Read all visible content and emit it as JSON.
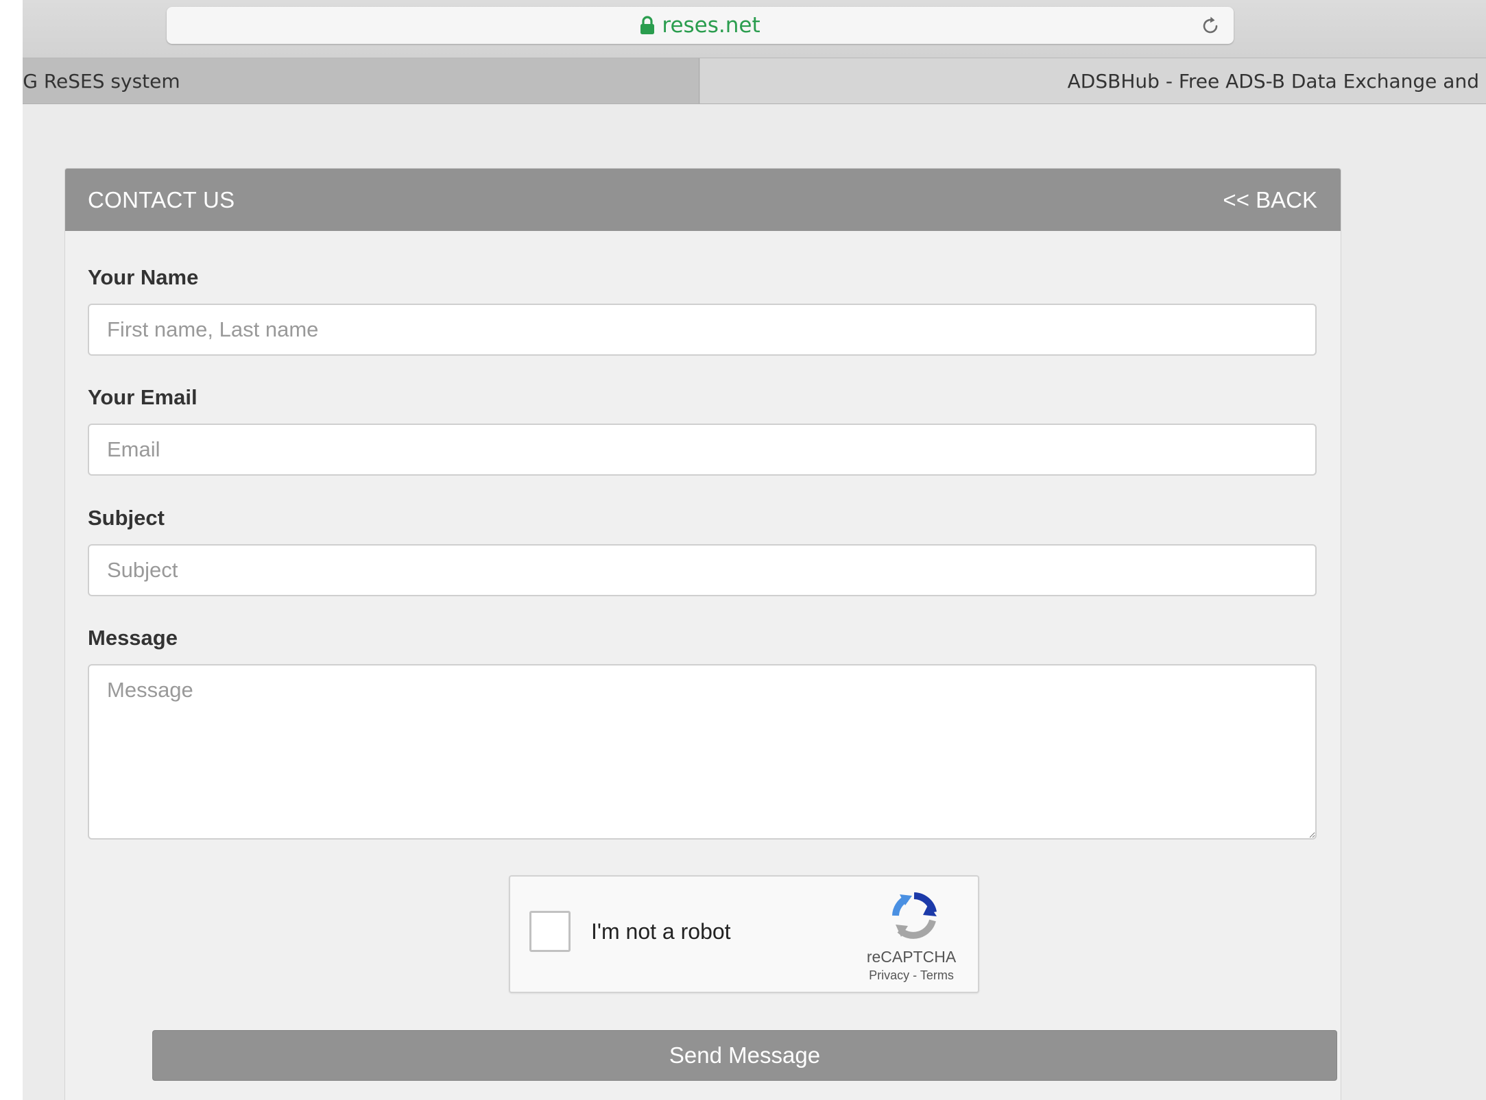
{
  "browser": {
    "url": "reses.net",
    "url_color": "#2a9d4e",
    "tabs": [
      {
        "label": "IG ReSES system",
        "active": true
      },
      {
        "label": "ADSBHub - Free ADS-B Data Exchange and",
        "active": false
      }
    ]
  },
  "panel": {
    "title": "CONTACT US",
    "back_label": "<< BACK",
    "header_color": "#929292"
  },
  "form": {
    "name": {
      "label": "Your Name",
      "placeholder": "First name, Last name",
      "value": ""
    },
    "email": {
      "label": "Your Email",
      "placeholder": "Email",
      "value": ""
    },
    "subject": {
      "label": "Subject",
      "placeholder": "Subject",
      "value": ""
    },
    "message": {
      "label": "Message",
      "placeholder": "Message",
      "value": ""
    }
  },
  "recaptcha": {
    "label": "I'm not a robot",
    "brand": "reCAPTCHA",
    "privacy": "Privacy",
    "separator": " - ",
    "terms": "Terms",
    "checked": false
  },
  "submit": {
    "label": "Send Message"
  }
}
